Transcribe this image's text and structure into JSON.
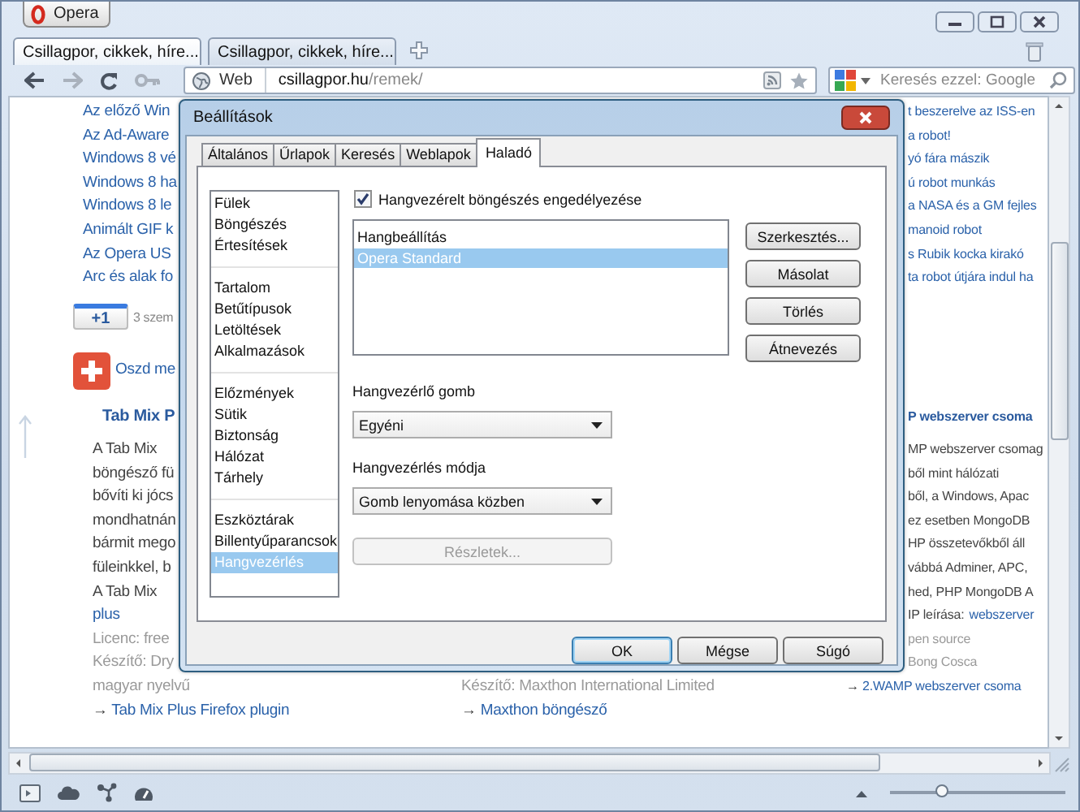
{
  "browser": {
    "menu_button": "Opera",
    "tabs": [
      {
        "title": "Csillagpor, cikkek, híre...",
        "selected": true
      },
      {
        "title": "Csillagpor, cikkek, híre...",
        "selected": false
      }
    ],
    "address": {
      "site_label": "Web",
      "host": "csillagpor.hu",
      "path": "/remek/"
    },
    "search": {
      "placeholder": "Keresés ezzel: Google"
    }
  },
  "page": {
    "left": {
      "links": [
        "Az előző Win",
        "Az Ad-Aware",
        "Windows 8 vé",
        "Windows 8 ha",
        "Windows 8 le",
        "Animált GIF k",
        "Az Opera US",
        "Arc és alak fo"
      ],
      "plus_one": {
        "label": "+1",
        "count": "3 szem"
      },
      "share": {
        "label": "Oszd me"
      },
      "article": {
        "title": "Tab Mix P",
        "lines": [
          {
            "kind": "text",
            "text": "A Tab Mix"
          },
          {
            "kind": "text",
            "text": "böngésző fü"
          },
          {
            "kind": "text",
            "text": "bővíti ki jócs"
          },
          {
            "kind": "text",
            "text": "mondhatnán"
          },
          {
            "kind": "text",
            "text": "bármit mego"
          },
          {
            "kind": "text",
            "text": "füleinkkel, b"
          },
          {
            "kind": "text",
            "text": "A Tab Mix"
          },
          {
            "kind": "link",
            "text": "plus"
          },
          {
            "kind": "muted",
            "text": "Licenc: free"
          },
          {
            "kind": "muted",
            "text": "Készítő: Dry"
          },
          {
            "kind": "muted",
            "text": "magyar nyelvű"
          },
          {
            "kind": "arrow-link",
            "arrow": "→",
            "text": "Tab Mix Plus Firefox plugin"
          }
        ]
      }
    },
    "middle": {
      "lines": [
        {
          "kind": "muted",
          "text": "Készítő: Maxthon International Limited"
        },
        {
          "kind": "arrow-link",
          "arrow": "→",
          "text": "Maxthon böngésző"
        }
      ]
    },
    "right": {
      "links": [
        "t beszerelve az ISS-en",
        "a robot!",
        "yó fára mászik",
        "ú robot munkás",
        "a NASA és a GM fejles",
        "manoid robot",
        "s Rubik kocka kirakó",
        "ta robot útjára indul ha"
      ],
      "article": {
        "title": "P webszerver csoma",
        "lines": [
          {
            "kind": "text",
            "text": "MP webszerver csomag"
          },
          {
            "kind": "text",
            "text": "ből mint hálózati"
          },
          {
            "kind": "text",
            "text": "ből, a Windows, Apac"
          },
          {
            "kind": "text",
            "text": "ez esetben MongoDB"
          },
          {
            "kind": "text",
            "text": "HP összetevőkből áll"
          },
          {
            "kind": "text",
            "text": "vábbá Adminer, APC,"
          },
          {
            "kind": "text",
            "text": "hed, PHP MongoDB A"
          },
          {
            "kind": "label-link",
            "text": "IP leírása:",
            "link": "webszerver"
          },
          {
            "kind": "muted",
            "text": "pen source"
          },
          {
            "kind": "muted",
            "text": "Bong Cosca"
          },
          {
            "kind": "arrow-link",
            "arrow": "→",
            "text": "2.WAMP webszerver csoma"
          }
        ]
      }
    }
  },
  "dialog": {
    "title": "Beállítások",
    "tabs": [
      {
        "label": "Általános",
        "selected": false
      },
      {
        "label": "Űrlapok",
        "selected": false
      },
      {
        "label": "Keresés",
        "selected": false
      },
      {
        "label": "Weblapok",
        "selected": false
      },
      {
        "label": "Haladó",
        "selected": true
      }
    ],
    "category_groups": [
      {
        "items": [
          {
            "label": "Fülek",
            "selected": false
          },
          {
            "label": "Böngészés",
            "selected": false
          },
          {
            "label": "Értesítések",
            "selected": false
          }
        ]
      },
      {
        "items": [
          {
            "label": "Tartalom",
            "selected": false
          },
          {
            "label": "Betűtípusok",
            "selected": false
          },
          {
            "label": "Letöltések",
            "selected": false
          },
          {
            "label": "Alkalmazások",
            "selected": false
          }
        ]
      },
      {
        "items": [
          {
            "label": "Előzmények",
            "selected": false
          },
          {
            "label": "Sütik",
            "selected": false
          },
          {
            "label": "Biztonság",
            "selected": false
          },
          {
            "label": "Hálózat",
            "selected": false
          },
          {
            "label": "Tárhely",
            "selected": false
          }
        ]
      },
      {
        "items": [
          {
            "label": "Eszköztárak",
            "selected": false
          },
          {
            "label": "Billentyűparancsok",
            "selected": false
          },
          {
            "label": "Hangvezérlés",
            "selected": true
          }
        ]
      }
    ],
    "enable_checkbox": {
      "label": "Hangvezérelt böngészés engedélyezése",
      "checked": true
    },
    "voice_list": {
      "header": "Hangbeállítás",
      "rows": [
        {
          "label": "Opera Standard",
          "selected": true
        }
      ]
    },
    "side_buttons": [
      "Szerkesztés...",
      "Másolat",
      "Törlés",
      "Átnevezés"
    ],
    "button_select": {
      "label": "Hangvezérlő gomb",
      "value": "Egyéni"
    },
    "mode_select": {
      "label": "Hangvezérlés módja",
      "value": "Gomb lenyomása közben"
    },
    "details_button": {
      "label": "Részletek...",
      "disabled": true
    },
    "footer_buttons": [
      {
        "label": "OK",
        "default": true
      },
      {
        "label": "Mégse",
        "default": false
      },
      {
        "label": "Súgó",
        "default": false
      }
    ]
  },
  "status_bar": {
    "zoom_slider": {
      "level": 0.3
    }
  }
}
